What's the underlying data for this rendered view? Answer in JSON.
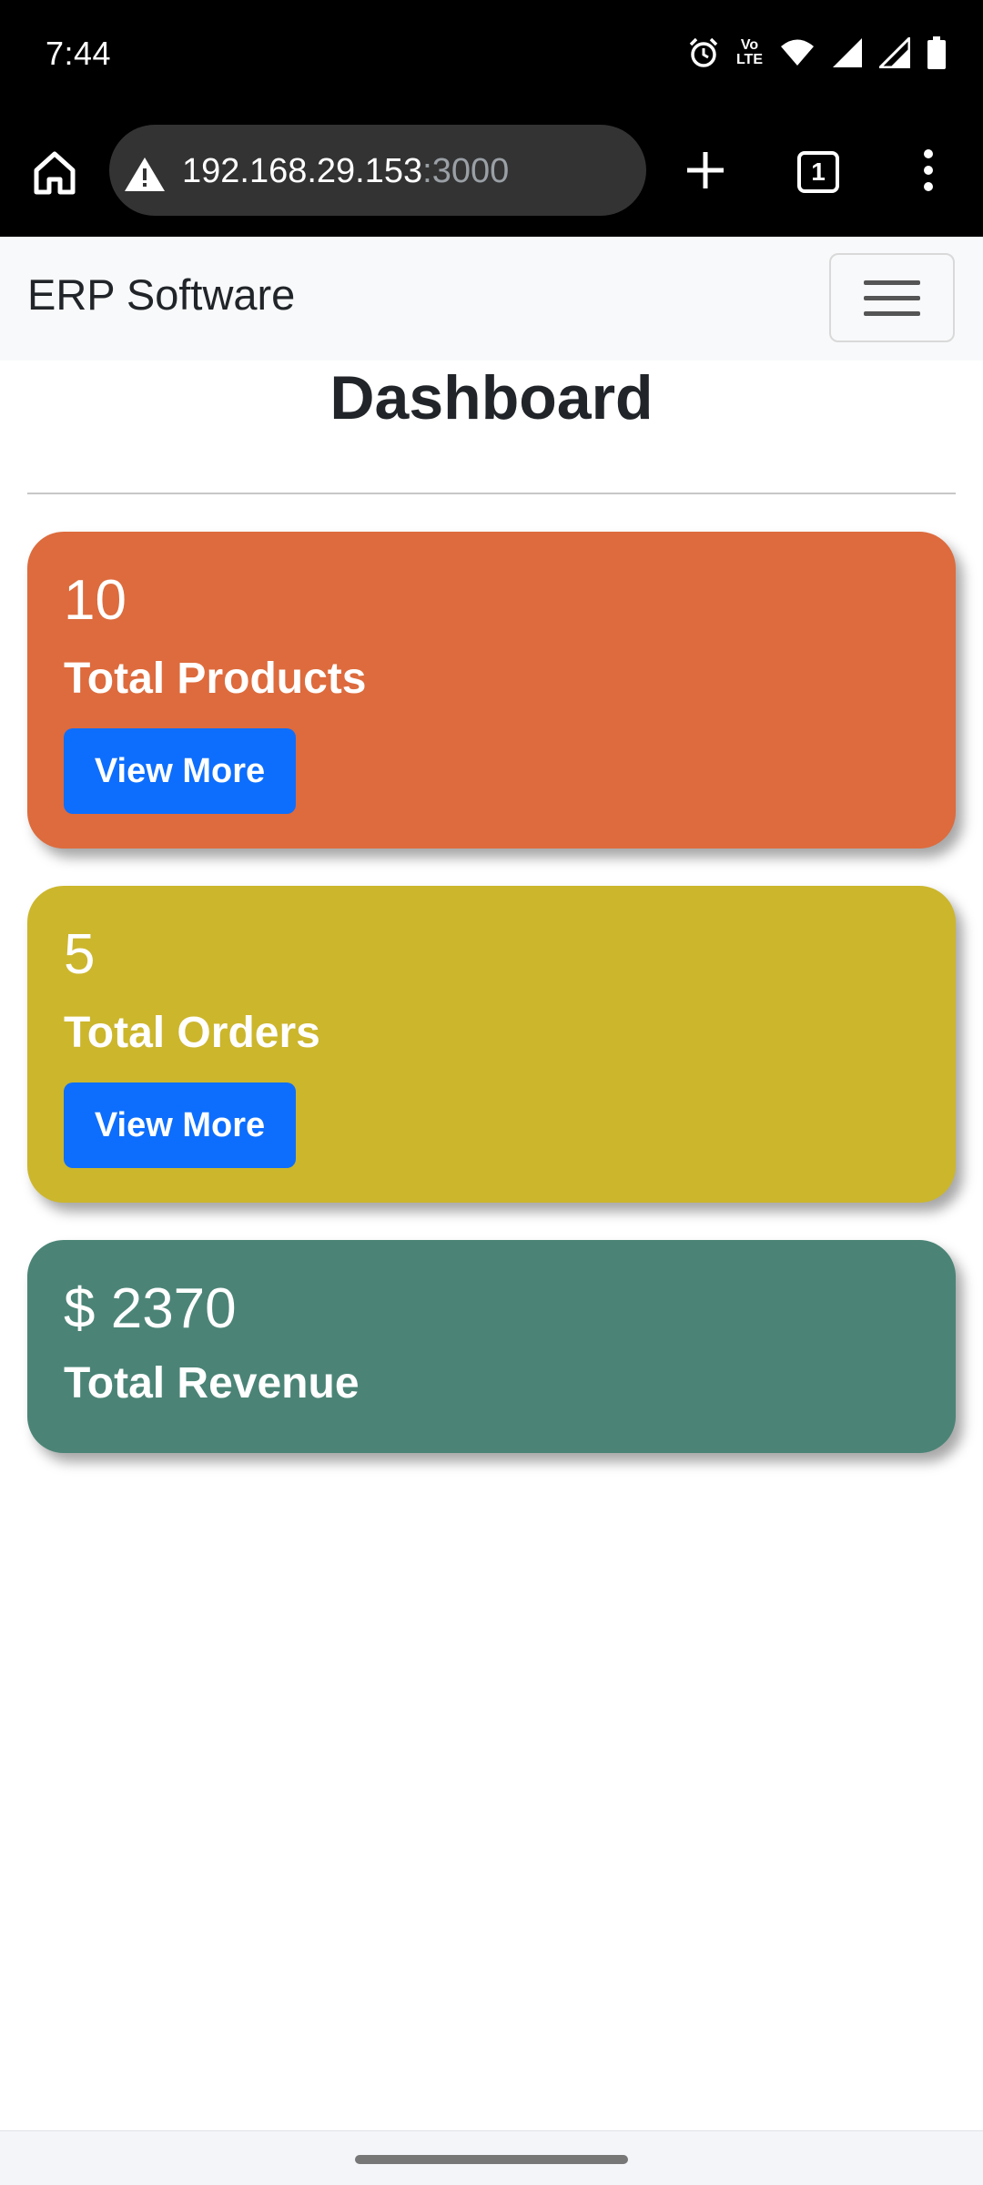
{
  "status_bar": {
    "time": "7:44",
    "network_label_top": "Vo",
    "network_label_bottom": "LTE",
    "icons": [
      "alarm-icon",
      "volte-icon",
      "wifi-icon",
      "signal-icon",
      "signal-icon",
      "battery-icon"
    ]
  },
  "browser": {
    "url_host": "192.168.29.153",
    "url_port": ":3000",
    "tab_count": "1",
    "icons": [
      "home-icon",
      "warning-icon",
      "plus-icon",
      "tabs-icon",
      "more-vert-icon"
    ]
  },
  "navbar": {
    "brand": "ERP Software",
    "toggler_icon": "hamburger-icon"
  },
  "page": {
    "title": "Dashboard"
  },
  "cards": [
    {
      "value": "10",
      "label": "Total Products",
      "button": "View More",
      "color": "#dd6b3d"
    },
    {
      "value": "5",
      "label": "Total Orders",
      "button": "View More",
      "color": "#ccb62c"
    },
    {
      "value": "$ 2370",
      "label": "Total Revenue",
      "color": "#4b8476"
    }
  ],
  "colors": {
    "button_primary": "#0d6efd",
    "navbar_bg": "#f8f9fa"
  }
}
